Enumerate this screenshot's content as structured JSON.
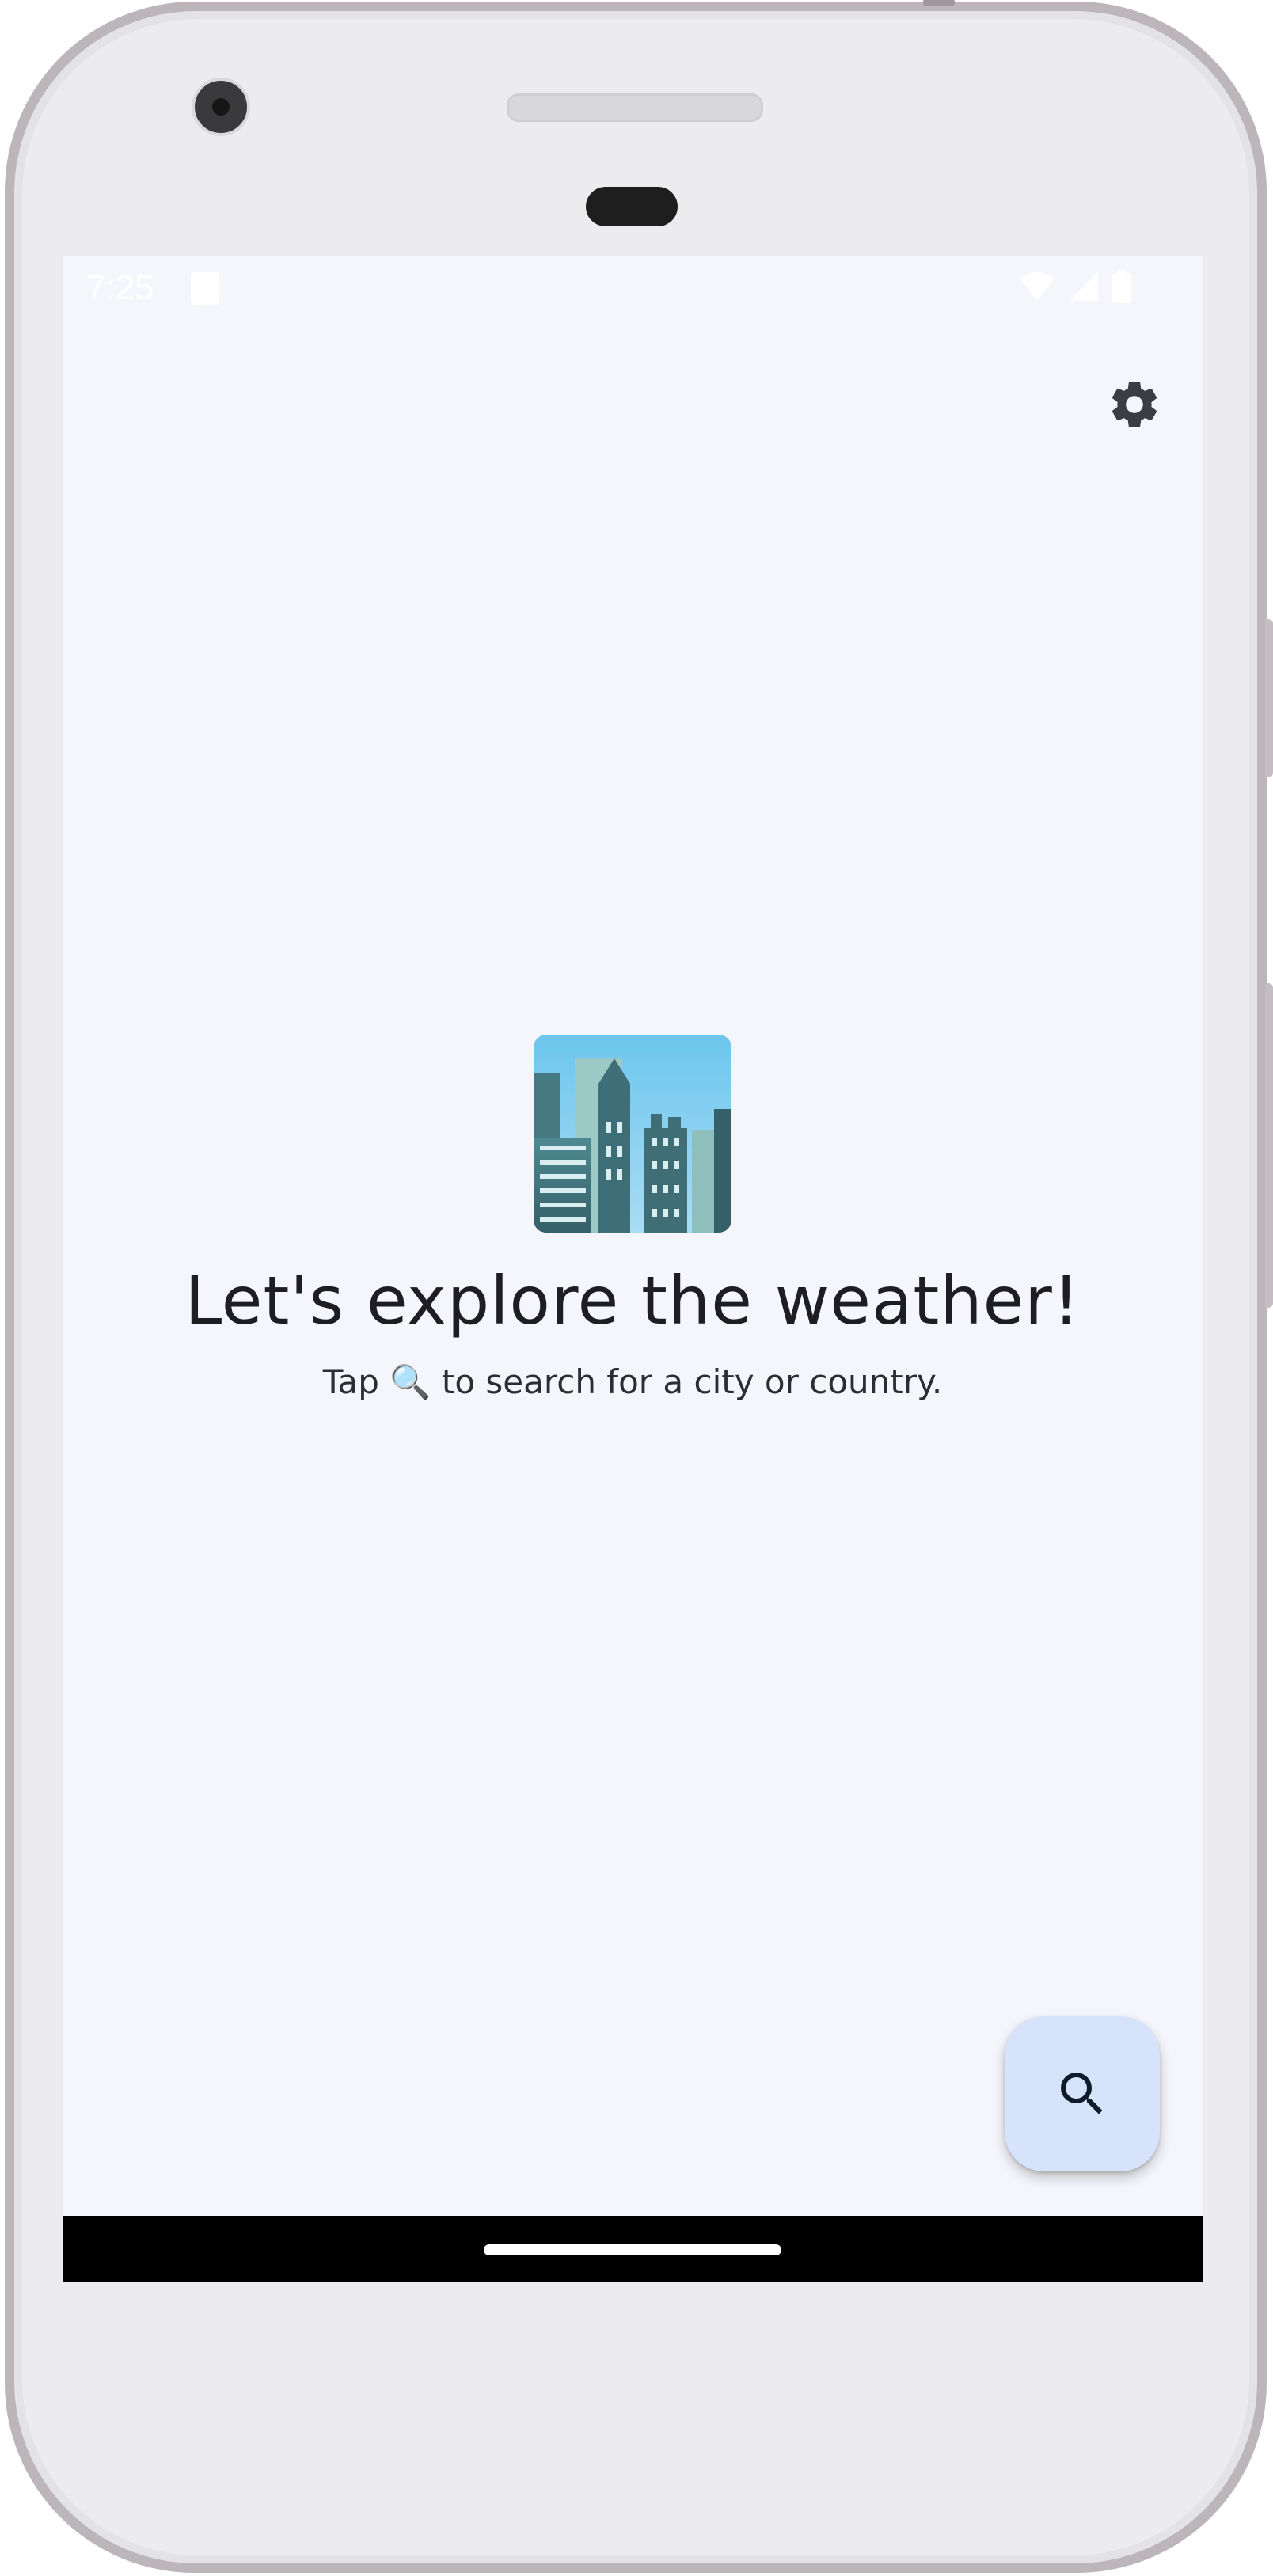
{
  "status_bar": {
    "time": "7:25"
  },
  "icons": {
    "settings": "gear-icon",
    "search": "search-icon",
    "city": "cityscape-emoji",
    "magnifier": "magnifying-glass-emoji"
  },
  "empty_state": {
    "title": "Let's explore the weather!",
    "subtitle_before": "Tap",
    "subtitle_emoji": "🔍",
    "subtitle_after": "to search for a city or country."
  },
  "colors": {
    "background": "#f5f6fb",
    "fab_background": "#d6e3fb",
    "icon": "#3a3d42",
    "text": "#1d1d22"
  }
}
